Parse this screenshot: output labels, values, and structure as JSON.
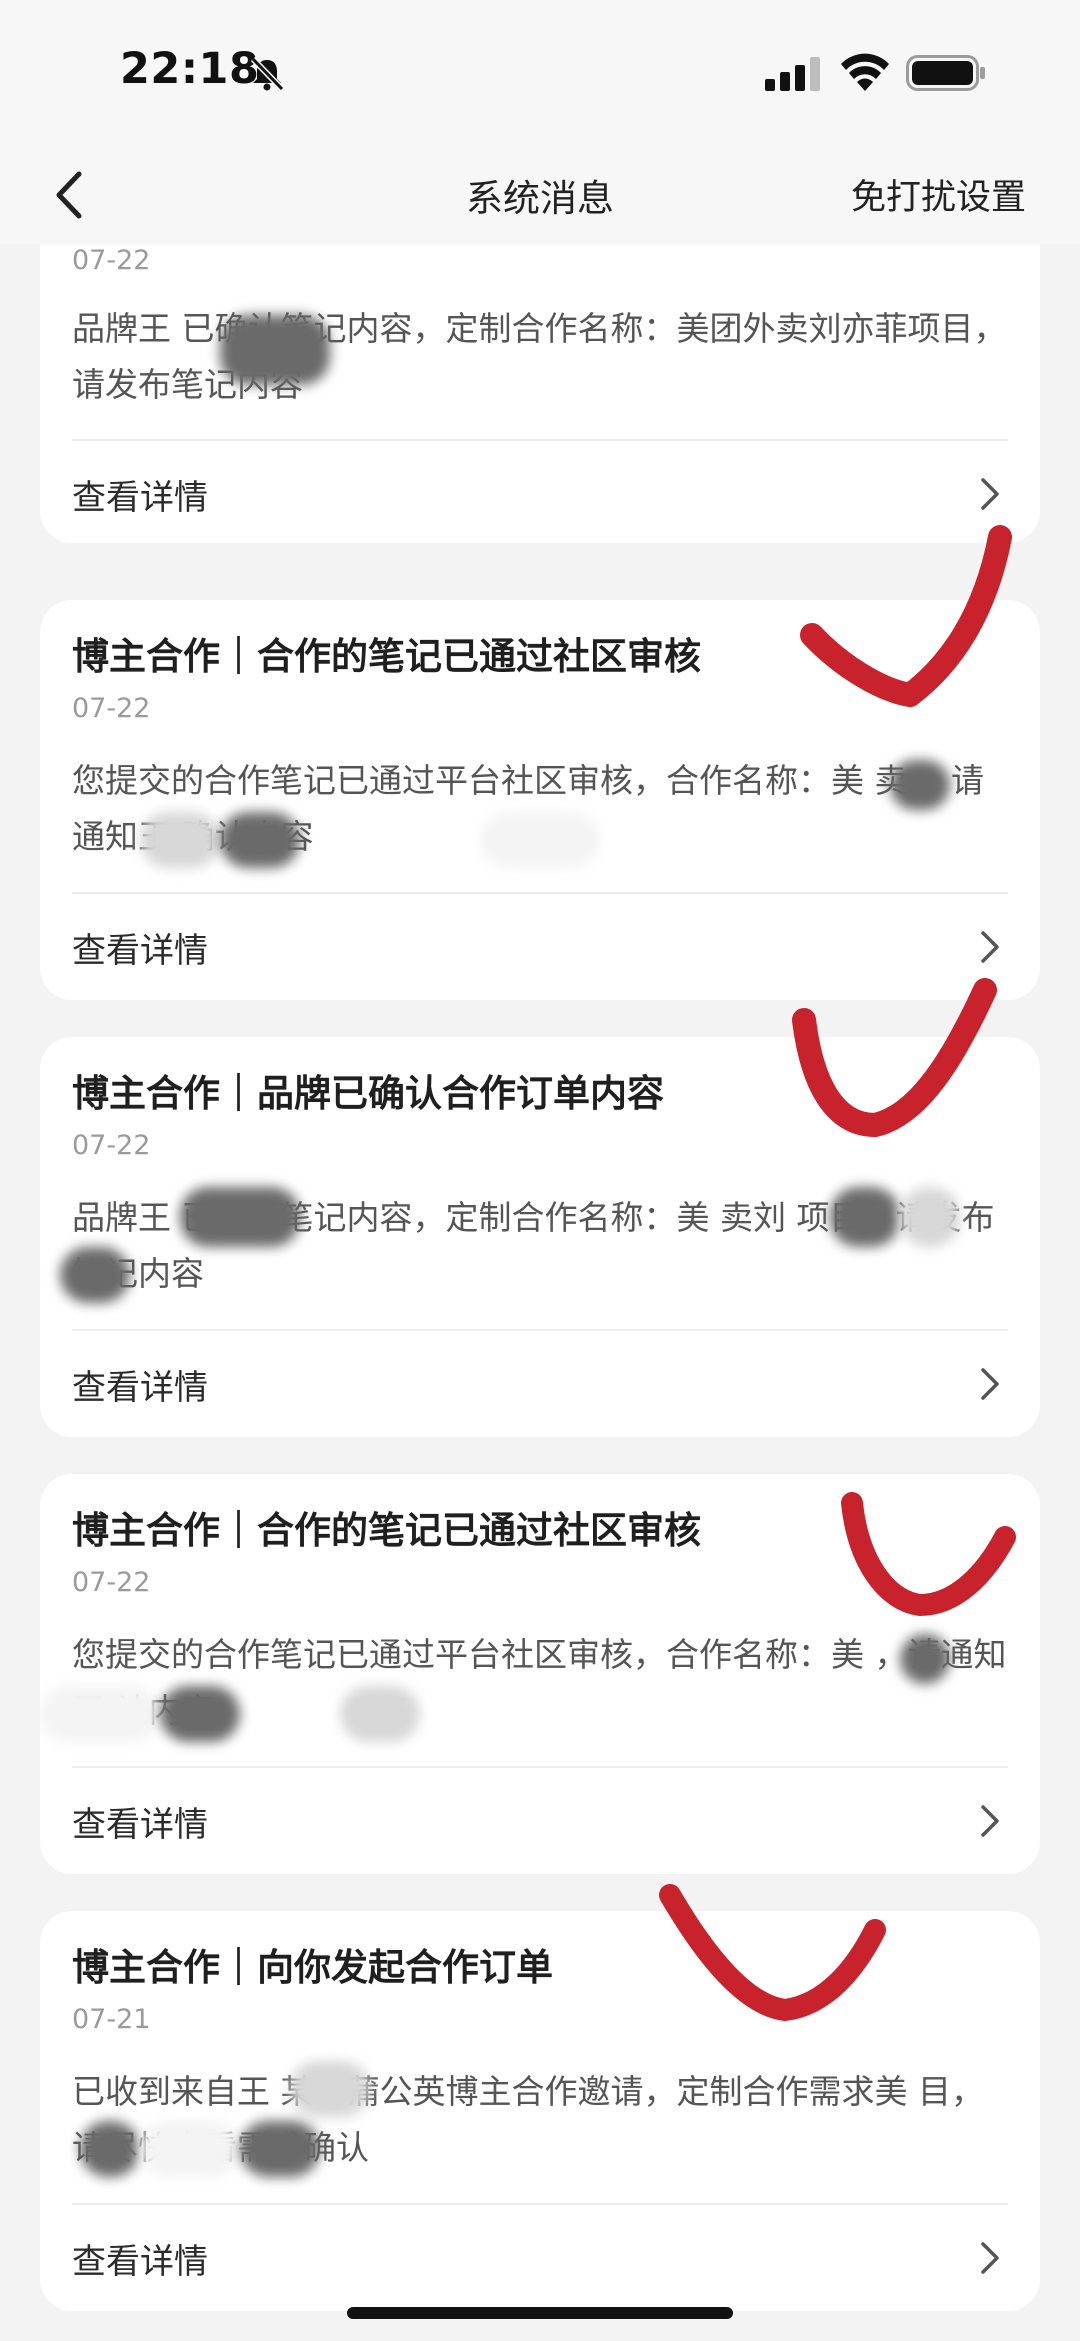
{
  "status_bar": {
    "time": "22:18",
    "icons": [
      "mute-bell-icon",
      "cellular-signal-icon",
      "wifi-icon",
      "battery-icon"
    ]
  },
  "nav": {
    "back_icon": "chevron-left-icon",
    "title": "系统消息",
    "action_label": "免打扰设置"
  },
  "messages": [
    {
      "title": "",
      "date": "07-22",
      "body": "品牌王 已确认笔记内容，定制合作名称：美团外卖刘亦菲项目，请发布笔记内容",
      "footer_label": "查看详情"
    },
    {
      "title": "博主合作｜合作的笔记已通过社区审核",
      "date": "07-22",
      "body": "您提交的合作笔记已通过平台社区审核，合作名称：美 卖 ，请通知王 确认内容",
      "footer_label": "查看详情"
    },
    {
      "title": "博主合作｜品牌已确认合作订单内容",
      "date": "07-22",
      "body": "品牌王 已确认笔记内容，定制合作名称：美 卖刘 项目，请发布笔记内容",
      "footer_label": "查看详情"
    },
    {
      "title": "博主合作｜合作的笔记已通过社区审核",
      "date": "07-22",
      "body": "您提交的合作笔记已通过平台社区审核，合作名称：美 ，请通知王 认内容",
      "footer_label": "查看详情"
    },
    {
      "title": "博主合作｜向你发起合作订单",
      "date": "07-21",
      "body": "已收到来自王 某的蒲公英博主合作邀请，定制合作需求美 目，请尽快查看需求确认",
      "footer_label": "查看详情"
    }
  ],
  "colors": {
    "background": "#f3f3f3",
    "card": "#ffffff",
    "annotation_red": "#c8232c",
    "muted_text": "#9a9a9a"
  }
}
